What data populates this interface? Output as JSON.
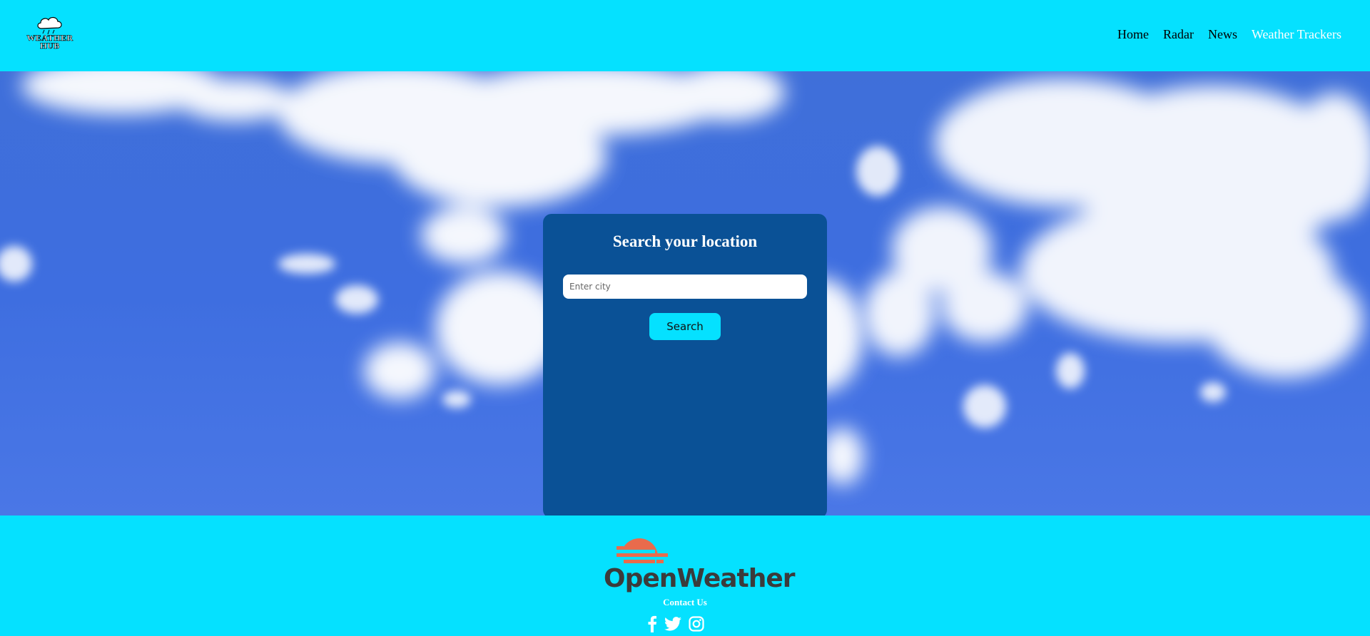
{
  "header": {
    "logo_text_line1": "WEATHER",
    "logo_text_line2": "HUB",
    "nav": [
      {
        "label": "Home"
      },
      {
        "label": "Radar"
      },
      {
        "label": "News"
      },
      {
        "label": "Weather Trackers"
      }
    ]
  },
  "search": {
    "title": "Search your location",
    "placeholder": "Enter city",
    "value": "",
    "button_label": "Search"
  },
  "footer": {
    "brand": "OpenWeather",
    "contact_label": "Contact Us",
    "social_icons": [
      "facebook-icon",
      "twitter-icon",
      "instagram-icon"
    ]
  },
  "colors": {
    "accent": "#05e1ff",
    "card": "#0a5196",
    "brand_orange": "#e96b4c",
    "brand_text": "#3b3b3b"
  }
}
